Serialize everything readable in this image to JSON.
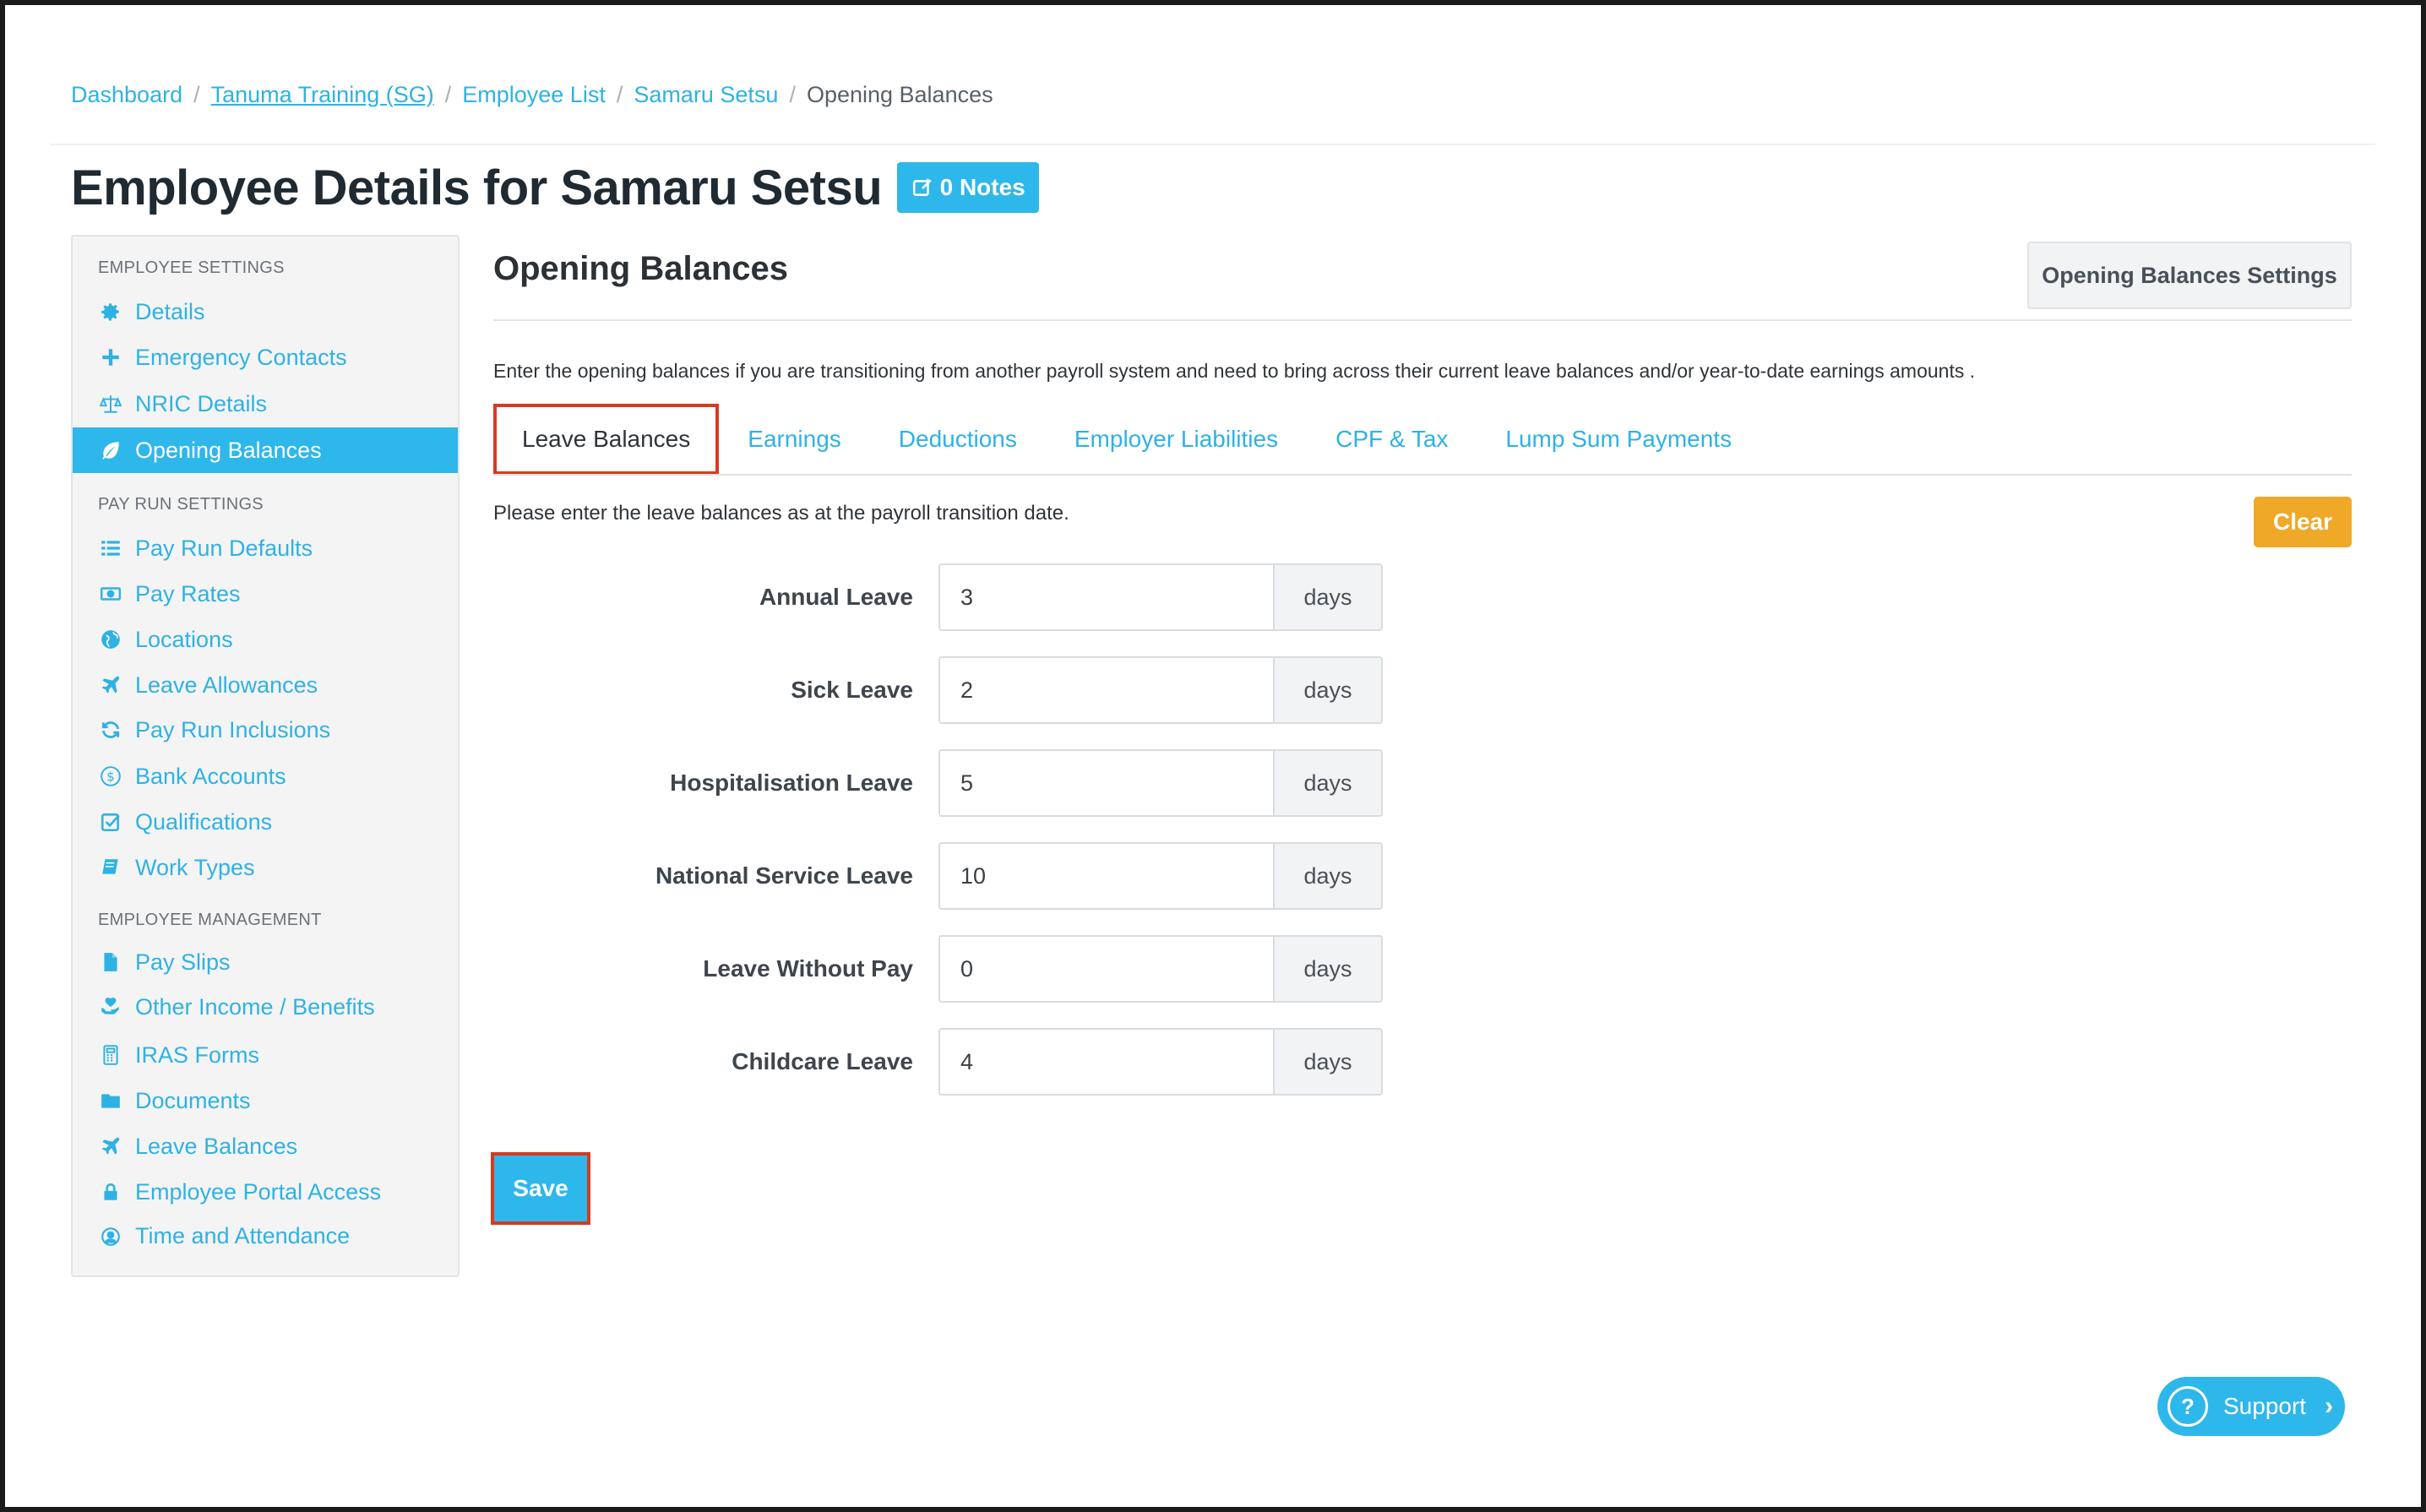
{
  "breadcrumb": [
    {
      "label": "Dashboard"
    },
    {
      "label": "Tanuma Training (SG)"
    },
    {
      "label": "Employee List"
    },
    {
      "label": "Samaru Setsu"
    },
    {
      "label": "Opening Balances"
    }
  ],
  "header": {
    "title": "Employee Details for Samaru Setsu",
    "notes_label": "0 Notes"
  },
  "sidebar": {
    "sections": [
      {
        "heading": "EMPLOYEE SETTINGS"
      },
      {
        "heading": "PAY RUN SETTINGS"
      },
      {
        "heading": "EMPLOYEE MANAGEMENT"
      }
    ],
    "items": [
      {
        "label": "Details",
        "icon": "gear-icon"
      },
      {
        "label": "Emergency Contacts",
        "icon": "plus-icon"
      },
      {
        "label": "NRIC Details",
        "icon": "scale-icon"
      },
      {
        "label": "Opening Balances",
        "icon": "leaf-icon"
      },
      {
        "label": "Pay Run Defaults",
        "icon": "list-icon"
      },
      {
        "label": "Pay Rates",
        "icon": "money-icon"
      },
      {
        "label": "Locations",
        "icon": "globe-icon"
      },
      {
        "label": "Leave Allowances",
        "icon": "plane-icon"
      },
      {
        "label": "Pay Run Inclusions",
        "icon": "refresh-icon"
      },
      {
        "label": "Bank Accounts",
        "icon": "dollar-circle-icon"
      },
      {
        "label": "Qualifications",
        "icon": "checkbox-icon"
      },
      {
        "label": "Work Types",
        "icon": "book-icon"
      },
      {
        "label": "Pay Slips",
        "icon": "file-icon"
      },
      {
        "label": "Other Income / Benefits",
        "icon": "hand-heart-icon"
      },
      {
        "label": "IRAS Forms",
        "icon": "calculator-icon"
      },
      {
        "label": "Documents",
        "icon": "folder-icon"
      },
      {
        "label": "Leave Balances",
        "icon": "plane-icon"
      },
      {
        "label": "Employee Portal Access",
        "icon": "lock-icon"
      },
      {
        "label": "Time and Attendance",
        "icon": "clock-user-icon"
      }
    ]
  },
  "main": {
    "section_title": "Opening Balances",
    "settings_button": "Opening Balances Settings",
    "intro": "Enter the opening balances if you are transitioning from another payroll system and need to bring across their current leave balances and/or year-to-date earnings amounts .",
    "tabs": [
      {
        "label": "Leave Balances"
      },
      {
        "label": "Earnings"
      },
      {
        "label": "Deductions"
      },
      {
        "label": "Employer Liabilities"
      },
      {
        "label": "CPF & Tax"
      },
      {
        "label": "Lump Sum Payments"
      }
    ],
    "leave_note": "Please enter the leave balances as at the payroll transition date.",
    "clear_label": "Clear",
    "leave_rows": [
      {
        "label": "Annual Leave",
        "value": "3",
        "unit": "days"
      },
      {
        "label": "Sick Leave",
        "value": "2",
        "unit": "days"
      },
      {
        "label": "Hospitalisation Leave",
        "value": "5",
        "unit": "days"
      },
      {
        "label": "National Service Leave",
        "value": "10",
        "unit": "days"
      },
      {
        "label": "Leave Without Pay",
        "value": "0",
        "unit": "days"
      },
      {
        "label": "Childcare Leave",
        "value": "4",
        "unit": "days"
      }
    ],
    "save_label": "Save"
  },
  "support": {
    "label": "Support"
  },
  "colors": {
    "accent": "#2eb7ea",
    "clear": "#efa827",
    "highlight": "#d63b1f"
  }
}
